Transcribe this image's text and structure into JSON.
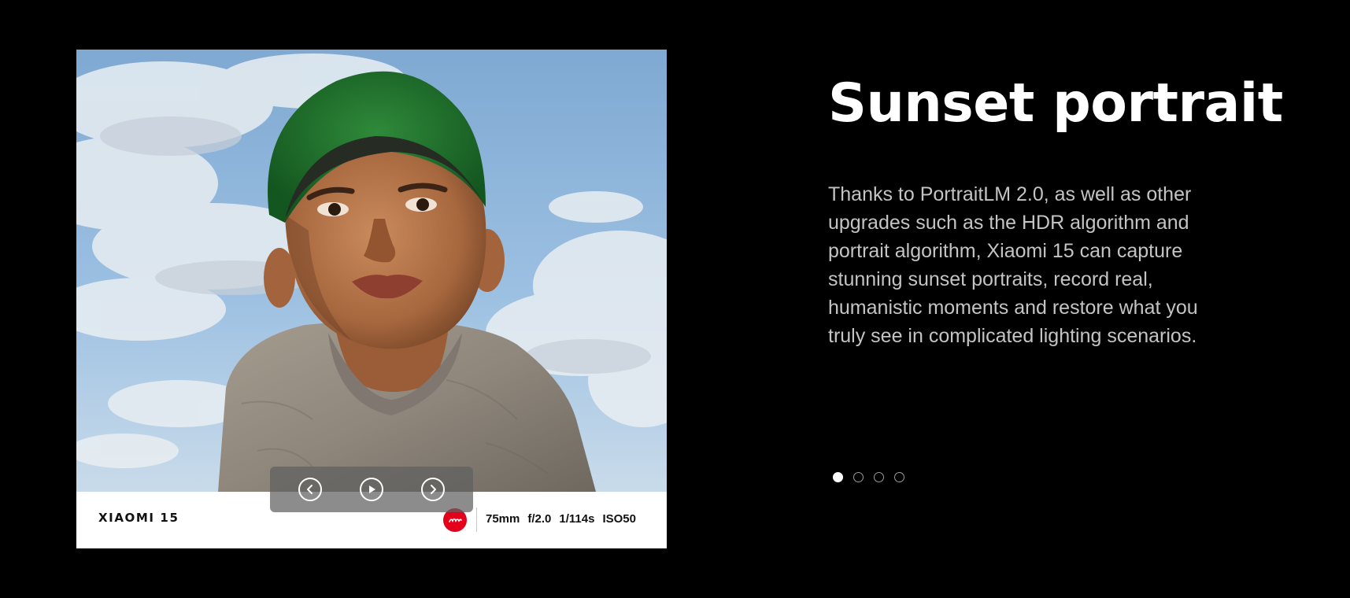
{
  "slide": {
    "title": "Sunset portrait",
    "description": "Thanks to PortraitLM 2.0, as well as other upgrades such as the HDR algorithm and portrait algorithm, Xiaomi 15 can capture stunning sunset portraits, record real, humanistic moments and restore what you truly see in complicated lighting scenarios."
  },
  "photo": {
    "watermark": {
      "brand": "XIAOMI 15",
      "logo": "Leica",
      "exif": [
        "75mm",
        "f/2.0",
        "1/114s",
        "ISO50"
      ]
    }
  },
  "controls": {
    "prev_icon": "chevron-left-icon",
    "play_icon": "play-icon",
    "next_icon": "chevron-right-icon"
  },
  "pagination": {
    "total": 4,
    "active_index": 0
  },
  "colors": {
    "background": "#000000",
    "title": "#ffffff",
    "body_text": "#c4c4c4",
    "leica_red": "#e2001a"
  }
}
